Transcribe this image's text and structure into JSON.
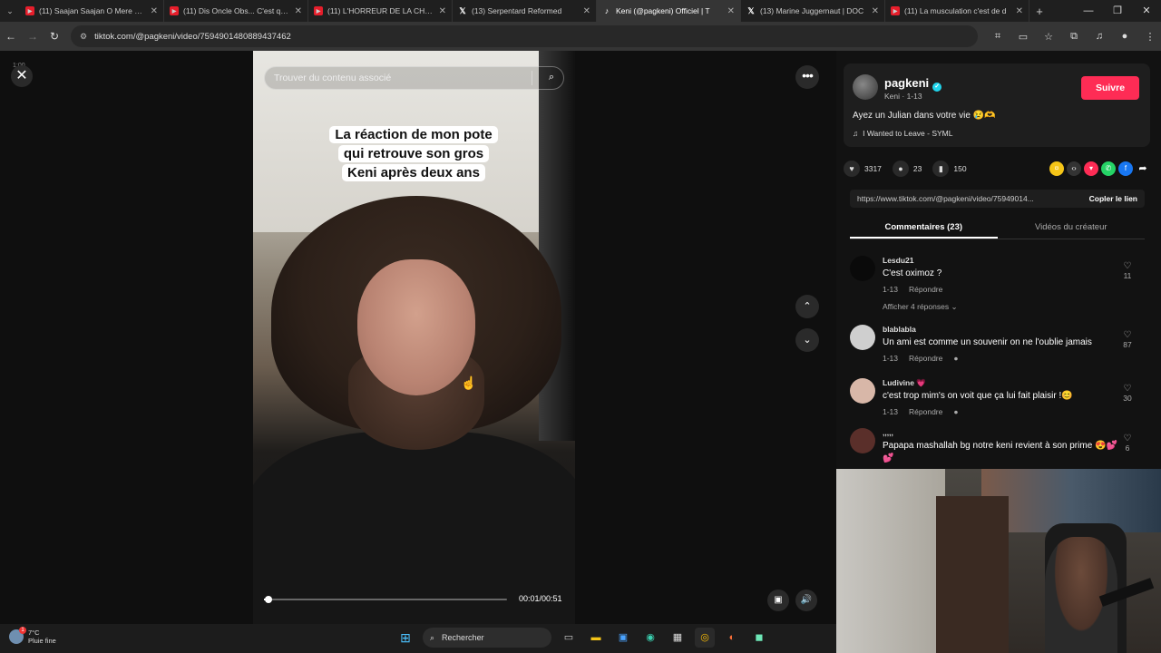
{
  "browser": {
    "tabs": [
      {
        "title": "(11) Saajan Saajan O Mere Saja",
        "favicon": "yt",
        "active": false
      },
      {
        "title": "(11) Dis Oncle Obs... C'est quoi",
        "favicon": "yt",
        "active": false
      },
      {
        "title": "(11) L'HORREUR DE LA CHIRUR",
        "favicon": "yt",
        "active": false
      },
      {
        "title": "(13) Serpentard Reformed",
        "favicon": "x",
        "active": false
      },
      {
        "title": "Keni (@pagkeni) Officiel | T",
        "favicon": "tt",
        "active": true
      },
      {
        "title": "(13) Marine Juggernaut | DOC",
        "favicon": "x",
        "active": false
      },
      {
        "title": "(11) La musculation c'est de d",
        "favicon": "yt",
        "active": false
      }
    ],
    "url": "tiktok.com/@pagkeni/video/7594901480889437462"
  },
  "video": {
    "search_placeholder": "Trouver du contenu associé",
    "caption_lines": [
      "La réaction de mon pote",
      "qui retrouve son gros",
      "Keni après deux ans"
    ],
    "time": "00:01/00:51",
    "mini_time": "1:00",
    "progress": 0.02
  },
  "author": {
    "username": "pagkeni",
    "subline": "Keni · 1-13",
    "follow_label": "Suivre",
    "description": "Ayez un Julian dans votre vie 😢🫶",
    "music": "I Wanted to Leave - SYML"
  },
  "stats": {
    "likes": "3317",
    "comments": "23",
    "saves": "150"
  },
  "share": {
    "link": "https://www.tiktok.com/@pagkeni/video/75949014...",
    "copy_label": "Copler le lien"
  },
  "panel_tabs": {
    "comments": "Commentaires (23)",
    "creator_videos": "Vidéos du créateur"
  },
  "comments": [
    {
      "user": "Lesdu21",
      "text": "C'est oximoz ?",
      "date": "1-13",
      "reply": "Répondre",
      "likes": "11",
      "more": "Afficher 4 réponses ⌄",
      "avatar_color": "#0a0a0a"
    },
    {
      "user": "blablabla",
      "text": "Un ami est comme un souvenir on ne l'oublie jamais",
      "date": "1-13",
      "reply": "Répondre",
      "likes": "87",
      "more": "",
      "avatar_color": "#cfcfcf"
    },
    {
      "user": "Ludivine 💗",
      "text": "c'est trop mim's on voit que ça lui fait plaisir !😊",
      "date": "1-13",
      "reply": "Répondre",
      "likes": "30",
      "more": "",
      "avatar_color": "#d8b7a8"
    },
    {
      "user": ",,,,,",
      "text": "Papapa mashallah bg notre keni revient à son prime 😍💕💕",
      "date": "",
      "reply": "",
      "likes": "6",
      "more": "",
      "avatar_color": "#5a2f2a"
    }
  ],
  "taskbar": {
    "temp": "7°C",
    "weather": "Pluie fine",
    "search": "Rechercher"
  }
}
